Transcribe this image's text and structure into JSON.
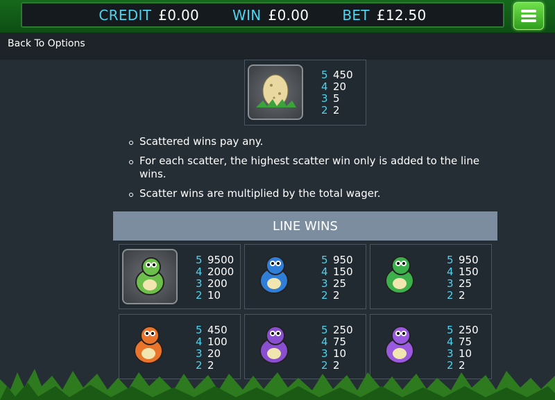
{
  "header": {
    "credit_label": "CREDIT",
    "credit_value": "£0.00",
    "win_label": "WIN",
    "win_value": "£0.00",
    "bet_label": "BET",
    "bet_value": "£12.50"
  },
  "nav": {
    "back_label": "Back To Options"
  },
  "scatter": {
    "symbol": "egg-icon",
    "pays": [
      {
        "n": "5",
        "v": "450"
      },
      {
        "n": "4",
        "v": "20"
      },
      {
        "n": "3",
        "v": "5"
      },
      {
        "n": "2",
        "v": "2"
      }
    ]
  },
  "rules": [
    "Scattered wins pay any.",
    "For each scatter, the highest scatter win only is added to the line wins.",
    "Scatter wins are multiplied by the total wager."
  ],
  "line_wins": {
    "title": "LINE WINS",
    "symbols": [
      {
        "name": "green-dino-mom-icon",
        "pays": [
          {
            "n": "5",
            "v": "9500"
          },
          {
            "n": "4",
            "v": "2000"
          },
          {
            "n": "3",
            "v": "200"
          },
          {
            "n": "2",
            "v": "10"
          }
        ]
      },
      {
        "name": "blue-dino-icon",
        "pays": [
          {
            "n": "5",
            "v": "950"
          },
          {
            "n": "4",
            "v": "150"
          },
          {
            "n": "3",
            "v": "25"
          },
          {
            "n": "2",
            "v": "2"
          }
        ]
      },
      {
        "name": "green-dino-icon",
        "pays": [
          {
            "n": "5",
            "v": "950"
          },
          {
            "n": "4",
            "v": "150"
          },
          {
            "n": "3",
            "v": "25"
          },
          {
            "n": "2",
            "v": "2"
          }
        ]
      },
      {
        "name": "orange-dino-icon",
        "pays": [
          {
            "n": "5",
            "v": "450"
          },
          {
            "n": "4",
            "v": "100"
          },
          {
            "n": "3",
            "v": "20"
          },
          {
            "n": "2",
            "v": "2"
          }
        ]
      },
      {
        "name": "purple-dino-icon",
        "pays": [
          {
            "n": "5",
            "v": "250"
          },
          {
            "n": "4",
            "v": "75"
          },
          {
            "n": "3",
            "v": "10"
          },
          {
            "n": "2",
            "v": "2"
          }
        ]
      },
      {
        "name": "purple-dino-shell-icon",
        "pays": [
          {
            "n": "5",
            "v": "250"
          },
          {
            "n": "4",
            "v": "75"
          },
          {
            "n": "3",
            "v": "10"
          },
          {
            "n": "2",
            "v": "2"
          }
        ]
      }
    ]
  },
  "colors": {
    "accent": "#4fd3ee",
    "header_green": "#16691c",
    "section_bg": "#7b8d9f",
    "page_bg": "#252d35"
  }
}
